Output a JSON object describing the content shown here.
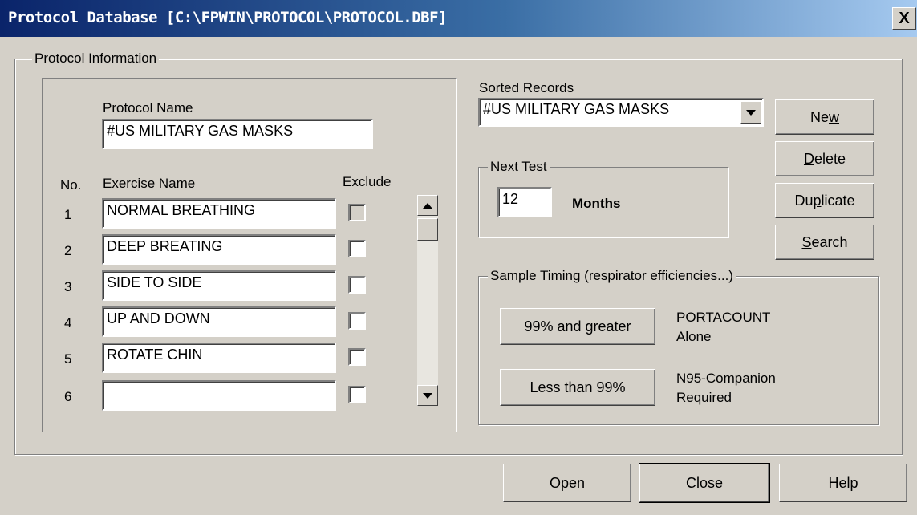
{
  "window": {
    "title": "Protocol Database [C:\\FPWIN\\PROTOCOL\\PROTOCOL.DBF]",
    "close_glyph": "X"
  },
  "protocol_info": {
    "legend": "Protocol Information",
    "protocol_name_label": "Protocol Name",
    "protocol_name_value": "#US MILITARY GAS MASKS",
    "col_no": "No.",
    "col_exercise": "Exercise Name",
    "col_exclude": "Exclude",
    "rows": [
      {
        "no": "1",
        "name": "NORMAL BREATHING",
        "exclude_disabled": true
      },
      {
        "no": "2",
        "name": "DEEP BREATING",
        "exclude_disabled": false
      },
      {
        "no": "3",
        "name": "SIDE TO SIDE",
        "exclude_disabled": false
      },
      {
        "no": "4",
        "name": "UP AND DOWN",
        "exclude_disabled": false
      },
      {
        "no": "5",
        "name": "ROTATE CHIN",
        "exclude_disabled": false
      },
      {
        "no": "6",
        "name": "",
        "exclude_disabled": false
      }
    ]
  },
  "sorted_records": {
    "label": "Sorted Records",
    "selected": "#US MILITARY GAS MASKS"
  },
  "next_test": {
    "legend": "Next Test",
    "value": "12",
    "unit": "Months"
  },
  "side_buttons": {
    "new_pre": "Ne",
    "new_key": "w",
    "new_post": "",
    "delete_pre": "",
    "delete_key": "D",
    "delete_post": "elete",
    "duplicate_pre": "Du",
    "duplicate_key": "p",
    "duplicate_post": "licate",
    "search_pre": "",
    "search_key": "S",
    "search_post": "earch"
  },
  "sample_timing": {
    "legend": "Sample Timing (respirator efficiencies...)",
    "btn1": "99% and greater",
    "desc1_line1": "PORTACOUNT",
    "desc1_line2": "Alone",
    "btn2": "Less than 99%",
    "desc2_line1": "N95-Companion",
    "desc2_line2": "Required"
  },
  "footer": {
    "open_key": "O",
    "open_post": "pen",
    "close_key": "C",
    "close_post": "lose",
    "help_key": "H",
    "help_post": "elp"
  }
}
